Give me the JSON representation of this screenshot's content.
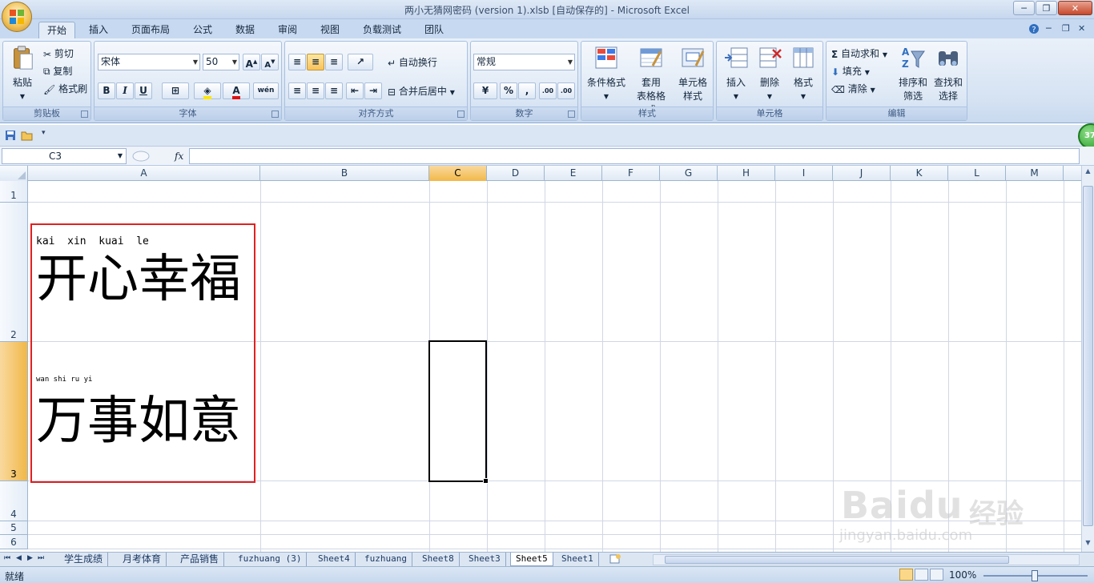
{
  "window": {
    "title": "两小无猜网密码 (version 1).xlsb [自动保存的] - Microsoft Excel",
    "minimize": "─",
    "restore": "❐",
    "close": "✕"
  },
  "tabs": [
    "开始",
    "插入",
    "页面布局",
    "公式",
    "数据",
    "审阅",
    "视图",
    "负载测试",
    "团队"
  ],
  "active_tab": "开始",
  "ribbon": {
    "clipboard": {
      "label": "剪贴板",
      "paste": "粘贴",
      "cut": "剪切",
      "copy": "复制",
      "format_painter": "格式刷"
    },
    "font": {
      "label": "字体",
      "font_name": "宋体",
      "font_size": "50",
      "bold": "B",
      "italic": "I",
      "underline": "U",
      "grow": "A",
      "shrink": "A",
      "phonetic": "wén"
    },
    "alignment": {
      "label": "对齐方式",
      "wrap": "自动换行",
      "merge": "合并后居中"
    },
    "number": {
      "label": "数字",
      "format": "常规",
      "percent": "%",
      "comma": ",",
      "inc_decimal": ".00",
      "dec_decimal": ".00"
    },
    "styles": {
      "label": "样式",
      "conditional": "条件格式",
      "table_l1": "套用",
      "table_l2": "表格格式",
      "cell_l1": "单元格",
      "cell_l2": "样式"
    },
    "cells": {
      "label": "单元格",
      "insert": "插入",
      "delete": "删除",
      "format": "格式"
    },
    "editing": {
      "label": "编辑",
      "autosum": "自动求和",
      "fill": "填充",
      "clear": "清除",
      "sort_l1": "排序和",
      "sort_l2": "筛选",
      "find_l1": "查找和",
      "find_l2": "选择"
    }
  },
  "badge": "37",
  "formula_bar": {
    "name_box": "C3",
    "fx": "fx",
    "content": ""
  },
  "columns": [
    "A",
    "B",
    "C",
    "D",
    "E",
    "F",
    "G",
    "H",
    "I",
    "J",
    "K",
    "L",
    "M"
  ],
  "rows": [
    "1",
    "2",
    "3",
    "4",
    "5",
    "6"
  ],
  "selected_cell": "C3",
  "cells": {
    "A2": {
      "pinyin": "kai  xin  kuai  le",
      "text": "开心幸福"
    },
    "A3": {
      "pinyin": "wan shi ru yi",
      "text": "万事如意"
    }
  },
  "sheets": [
    "学生成绩",
    "月考体育",
    "产品销售",
    "fuzhuang (3)",
    "Sheet4",
    "fuzhuang",
    "Sheet8",
    "Sheet3",
    "Sheet5",
    "Sheet1"
  ],
  "active_sheet": "Sheet5",
  "status": {
    "text": "就绪",
    "zoom": "100%"
  },
  "watermark": {
    "brand": "Baidu",
    "cn": "经验",
    "url": "jingyan.baidu.com"
  },
  "colors": {
    "selection_highlight": "#f1b848",
    "annotation_box": "#e02020",
    "ribbon_bg": "#d6e3f3"
  }
}
